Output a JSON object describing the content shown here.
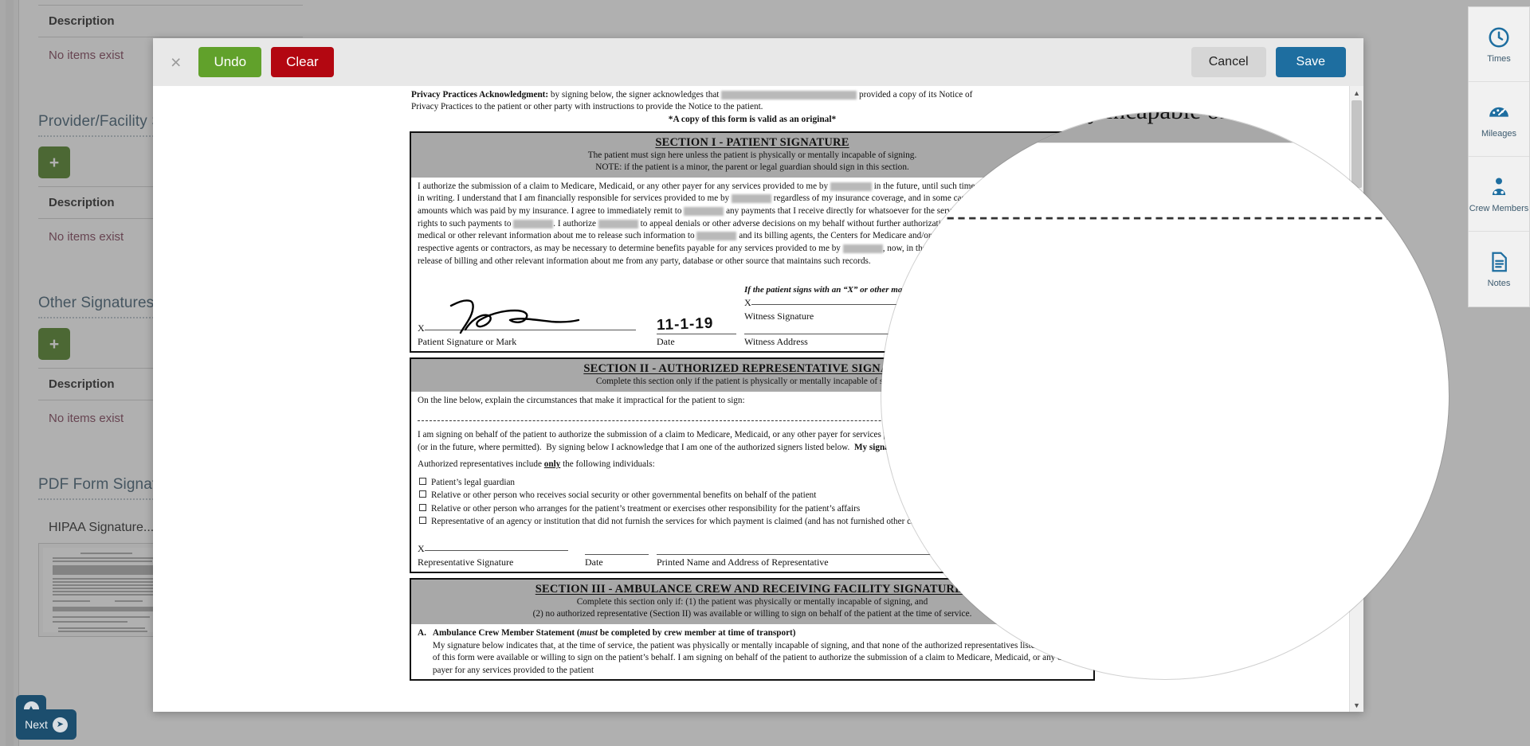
{
  "sidebar": {
    "sections": [
      {
        "title": "",
        "desc_header": "Description",
        "empty_text": "No items exist"
      },
      {
        "title": "Provider/Facility Signatures",
        "desc_header": "Description",
        "empty_text": "No items exist"
      },
      {
        "title": "Other Signatures",
        "desc_header": "Description",
        "empty_text": "No items exist"
      },
      {
        "title": "PDF Form Signatures",
        "desc_header": "",
        "empty_text": ""
      }
    ],
    "add_label": "+",
    "pdf_form_signature_item": "HIPAA Signature...",
    "bottom_nav": {
      "next_label": "Next",
      "up_icon": "chevron-up-icon",
      "next_icon": "arrow-right-icon"
    }
  },
  "tool_rail": {
    "items": [
      {
        "label": "Times",
        "icon": "clock-icon"
      },
      {
        "label": "Mileages",
        "icon": "speedometer-icon"
      },
      {
        "label": "Crew Members",
        "icon": "person-icon"
      },
      {
        "label": "Notes",
        "icon": "notes-icon"
      }
    ]
  },
  "modal": {
    "close_label": "×",
    "undo_label": "Undo",
    "clear_label": "Clear",
    "cancel_label": "Cancel",
    "save_label": "Save"
  },
  "document": {
    "privacy_label": "Privacy Practices Acknowledgment:",
    "privacy_text_1": " by signing below, the signer acknowledges that",
    "privacy_text_2": "provided a copy of its Notice of",
    "privacy_text_3": "Privacy Practices to the patient or other party with instructions to provide the Notice to the patient.",
    "valid_original": "*A copy of this form is valid as an original*",
    "section1": {
      "heading": "SECTION I - PATIENT SIGNATURE",
      "sub1": "The patient must sign here unless the patient is physically or mentally incapable of signing.",
      "sub2": "NOTE: if the patient is a minor, the parent or legal guardian should sign in this section.",
      "body": "I authorize the submission of a claim to Medicare, Medicaid, or any other payer for any services provided to me by ______ in the future, until such time as I revoke this authorization in writing. I understand that I am financially responsible for services provided to me by ______ regardless of my insurance coverage, and in some cases, may be responsible for amounts which was paid by my insurance. I agree to immediately remit to ______ any payments that I receive directly for whatsoever for the services provided to me and I assign all rights to such payments to ______. I authorize ______ to appeal denials or other adverse decisions on my behalf without further authorization. I authorize and direct any holder of medical or other relevant information about me to release such information to ______ and its billing agents, the Centers for Medicare and Medicaid and/or any other payers or insurers, and their respective agents or contractors, as may be necessary to determine benefits payable for any services provided to me by ______, now, in the past, or in the future.  I also authorize the release of medical, billing and other relevant information about me from any party, database or other source that maintains such records.",
      "sig_x": "X",
      "sig_caption": "Patient Signature or Mark",
      "date_value": "11-1-19",
      "date_caption": "Date",
      "witness_note": "If the patient signs with an “X” or other mark:",
      "witness_sig_caption": "Witness Signature",
      "witness_addr_caption": "Witness Address"
    },
    "section2": {
      "heading": "SECTION II - AUTHORIZED REPRESENTATIVE SIGNATURE",
      "sub1": "Complete this section only if the patient is physically or mentally incapable of signing.",
      "line_prompt": "On the line below, explain the circumstances that make it impractical for the patient to sign:",
      "body1": "I am signing on behalf of the patient to authorize the submission of a claim to Medicare, Medicaid, or any other payer for services provided to the patient by ______ now or in the past, (or in the future, where permitted).  By signing below I acknowledge that I am one of the authorized signers listed below.",
      "bold_clause": "My signature is not an acceptance of financial responsibility.",
      "reps_intro_1": "Authorized representatives include ",
      "reps_intro_only": "only",
      "reps_intro_2": " the following individuals:",
      "reps": [
        "Patient’s legal guardian",
        "Relative or other person who receives social security or other governmental benefits on behalf of the patient",
        "Relative or other person who arranges for the patient’s treatment or exercises other responsibility for the patient’s affairs",
        "Representative of an agency or institution that did not furnish the services for which payment is claimed (and has not furnished other care, services, or assistance to the patient"
      ],
      "rep_sig_x": "X",
      "rep_sig_caption": "Representative Signature",
      "rep_date_caption": "Date",
      "rep_name_caption": "Printed Name and Address of Representative"
    },
    "section3": {
      "heading": "SECTION III - AMBULANCE CREW AND RECEIVING FACILITY SIGNATURES",
      "sub1": "Complete this section only if: (1) the patient was physically or mentally incapable of signing, and",
      "sub2": "(2) no authorized representative (Section II) was available or willing to sign on behalf of the patient at the time of service.",
      "item_a_label": "A.",
      "item_a_title": "Ambulance Crew Member Statement (must be completed by crew member at time of transport)",
      "item_a_body": "My signature below indicates that, at the time of service, the patient was physically or mentally incapable of signing, and that none of the authorized representatives listed in Section II of this form were available or willing to sign on the patient’s behalf.  I am signing on behalf of the patient to authorize the submission of a claim to Medicare, Medicaid, or any other payer for any services provided to the patient"
    }
  },
  "colors": {
    "accent_blue": "#1e6ea0",
    "green": "#61a12b",
    "red": "#b30711",
    "rail_blue": "#1c4e6e",
    "add_green": "#4a7d1e"
  }
}
